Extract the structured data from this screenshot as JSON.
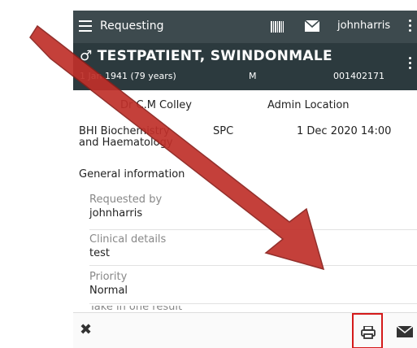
{
  "header": {
    "title": "Requesting",
    "user": "johnharris"
  },
  "patient": {
    "name": "TESTPATIENT, SWINDONMALE",
    "gender_symbol": "♂",
    "dob": "1 Jan 1941 (79 years)",
    "sex": "M",
    "id": "001402171"
  },
  "summary": {
    "clinician": "Dr C.M Colley",
    "location": "Admin Location",
    "department": "BHI Biochemistry and Haematology",
    "specimen": "SPC",
    "datetime": "1 Dec 2020 14:00"
  },
  "general_info_title": "General information",
  "details": [
    {
      "label": "Requested by",
      "value": "johnharris"
    },
    {
      "label": "Clinical details",
      "value": "test"
    },
    {
      "label": "Priority",
      "value": "Normal"
    },
    {
      "label": "Take in one result",
      "value": ""
    }
  ],
  "toolbar": {
    "close_glyph": "✖"
  },
  "colors": {
    "header_bg": "#3d4a4e",
    "banner_bg": "#2c3a3e",
    "arrow": "#c0302a",
    "highlight": "#d41a1a"
  }
}
